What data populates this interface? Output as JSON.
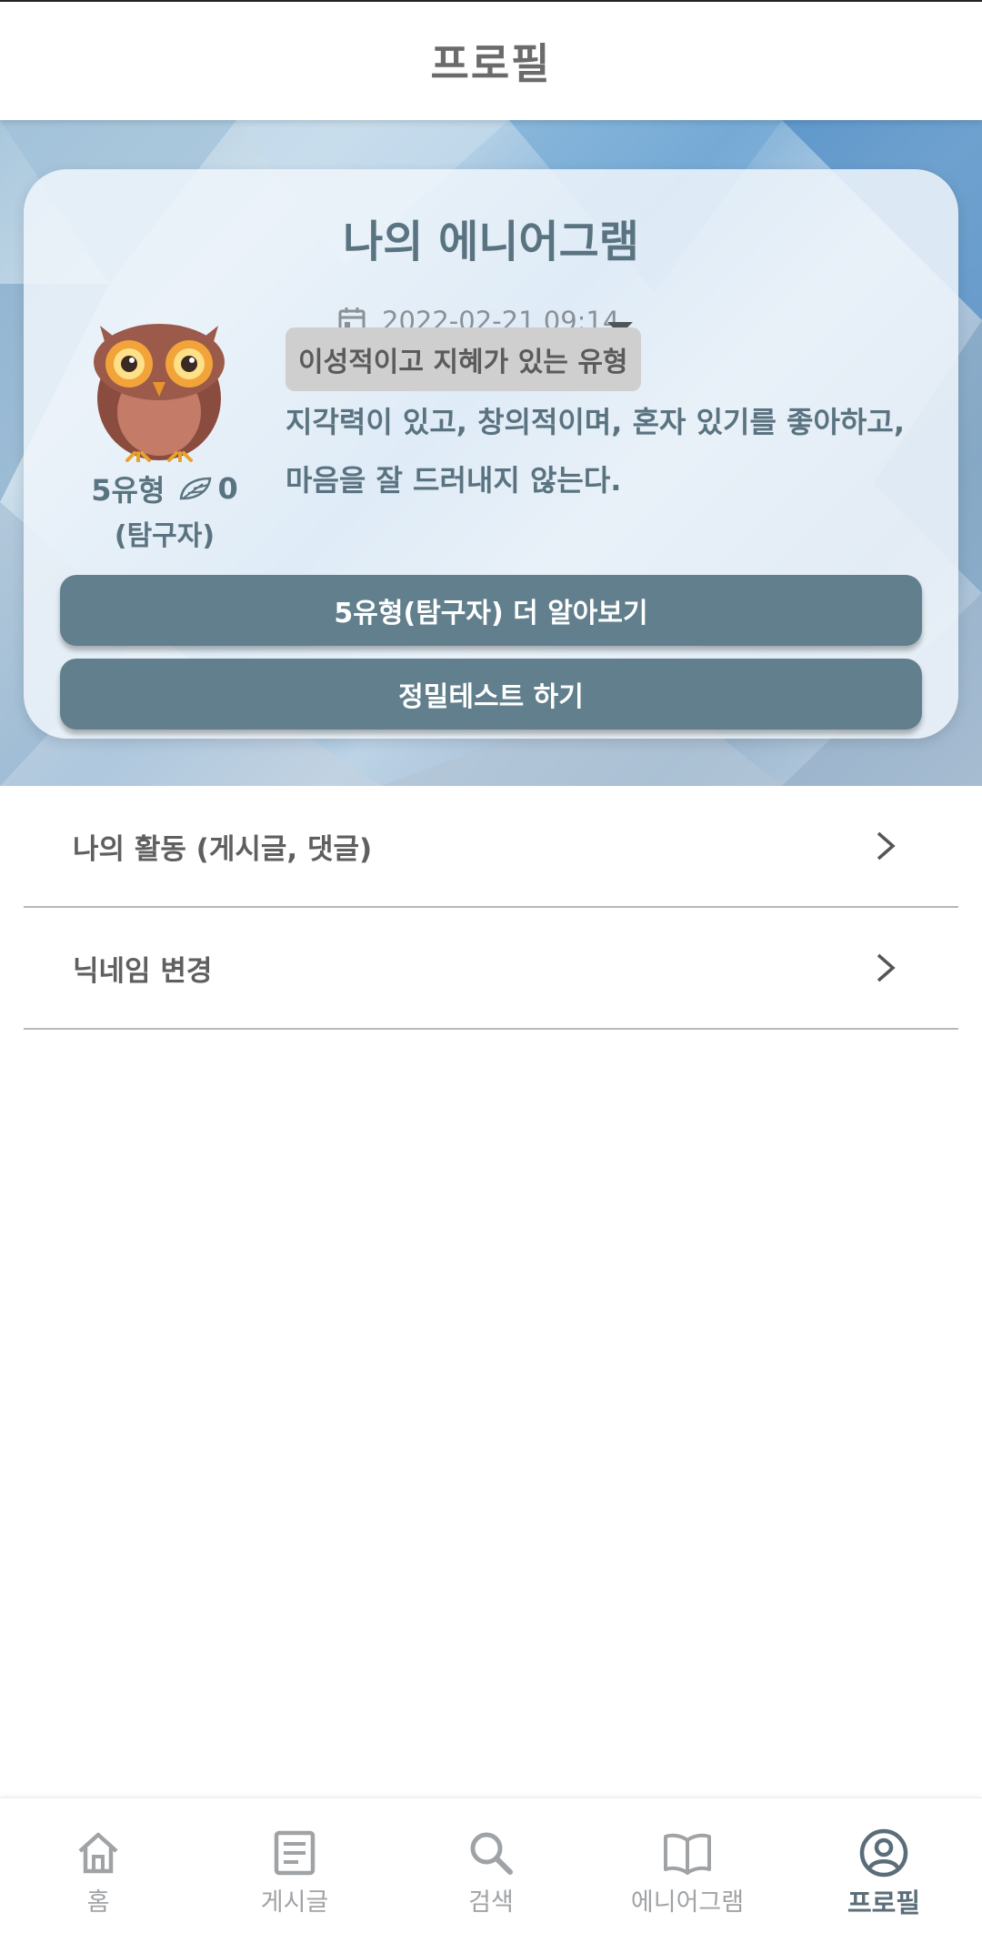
{
  "header": {
    "title": "프로필"
  },
  "enneagram": {
    "title": "나의 에니어그램",
    "date": "2022-02-21 09:14",
    "type_label": "5유형",
    "leaf_count": "0",
    "type_name": "(탐구자)",
    "tag": "이성적이고 지혜가 있는 유형",
    "description": "지각력이 있고, 창의적이며, 혼자 있기를 좋아하고, 마음을 잘 드러내지 않는다.",
    "learn_more_button": "5유형(탐구자) 더 알아보기",
    "detail_test_button": "정밀테스트 하기"
  },
  "menu": {
    "items": [
      {
        "label": "나의 활동 (게시글, 댓글)"
      },
      {
        "label": "닉네임 변경"
      }
    ]
  },
  "bottom_nav": {
    "items": [
      {
        "label": "홈",
        "icon": "home-icon"
      },
      {
        "label": "게시글",
        "icon": "document-icon"
      },
      {
        "label": "검색",
        "icon": "search-icon"
      },
      {
        "label": "에니어그램",
        "icon": "book-icon"
      },
      {
        "label": "프로필",
        "icon": "profile-icon",
        "active": true
      }
    ]
  },
  "colors": {
    "accent": "#617f8c",
    "title_text": "#5a7380",
    "tag_bg": "#cfcfcf"
  }
}
